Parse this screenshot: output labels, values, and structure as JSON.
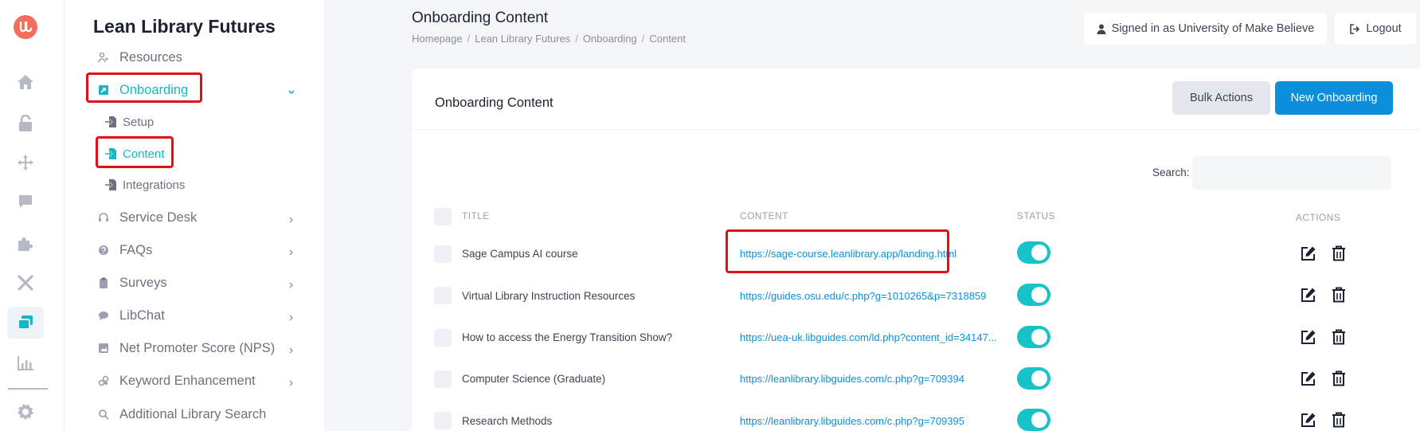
{
  "app": {
    "logo_text": "LL"
  },
  "rail": {
    "icons": [
      "home-icon",
      "unlock-icon",
      "move-icon",
      "chat-icon",
      "puzzle-icon",
      "tools-icon",
      "layers-icon",
      "chart-icon",
      "gear-icon"
    ],
    "active": "layers-icon"
  },
  "sidebar": {
    "title": "Lean Library Futures",
    "items": [
      {
        "label": "Resources",
        "icon": "people-icon"
      },
      {
        "label": "Onboarding",
        "icon": "onboarding-icon",
        "active": true
      },
      {
        "label": "Service Desk",
        "icon": "headset-icon"
      },
      {
        "label": "FAQs",
        "icon": "question-icon"
      },
      {
        "label": "Surveys",
        "icon": "clipboard-icon"
      },
      {
        "label": "LibChat",
        "icon": "chat-icon"
      },
      {
        "label": "Net Promoter Score (NPS)",
        "icon": "image-icon"
      },
      {
        "label": "Keyword Enhancement",
        "icon": "keyword-icon"
      },
      {
        "label": "Additional Library Search",
        "icon": "search-icon"
      }
    ],
    "onboarding_sub": [
      {
        "label": "Setup"
      },
      {
        "label": "Content",
        "active": true
      },
      {
        "label": "Integrations"
      }
    ]
  },
  "header": {
    "title": "Onboarding Content",
    "breadcrumb": [
      "Homepage",
      "Lean Library Futures",
      "Onboarding",
      "Content"
    ],
    "signed_in": "Signed in as University of Make Believe",
    "logout": "Logout"
  },
  "card": {
    "title": "Onboarding Content",
    "bulk_actions": "Bulk Actions",
    "new_onboarding": "New Onboarding",
    "search_label": "Search:",
    "search_value": "",
    "columns": [
      "TITLE",
      "CONTENT",
      "STATUS",
      "ACTIONS"
    ],
    "rows": [
      {
        "title": "Sage Campus AI course",
        "content": "https://sage-course.leanlibrary.app/landing.html",
        "status": "on"
      },
      {
        "title": "Virtual Library Instruction Resources",
        "content": "https://guides.osu.edu/c.php?g=1010265&p=7318859",
        "status": "on"
      },
      {
        "title": "How to access the Energy Transition Show?",
        "content": "https://uea-uk.libguides.com/ld.php?content_id=34147...",
        "status": "on"
      },
      {
        "title": "Computer Science (Graduate)",
        "content": "https://leanlibrary.libguides.com/c.php?g=709394",
        "status": "on"
      },
      {
        "title": "Research Methods",
        "content": "https://leanlibrary.libguides.com/c.php?g=709395",
        "status": "on"
      }
    ]
  },
  "colors": {
    "accent": "#14b8c4",
    "primary_button": "#0b8fdb",
    "toggle_on": "#17c3c9",
    "highlight": "#e0101a",
    "logo": "#f26d5b"
  }
}
